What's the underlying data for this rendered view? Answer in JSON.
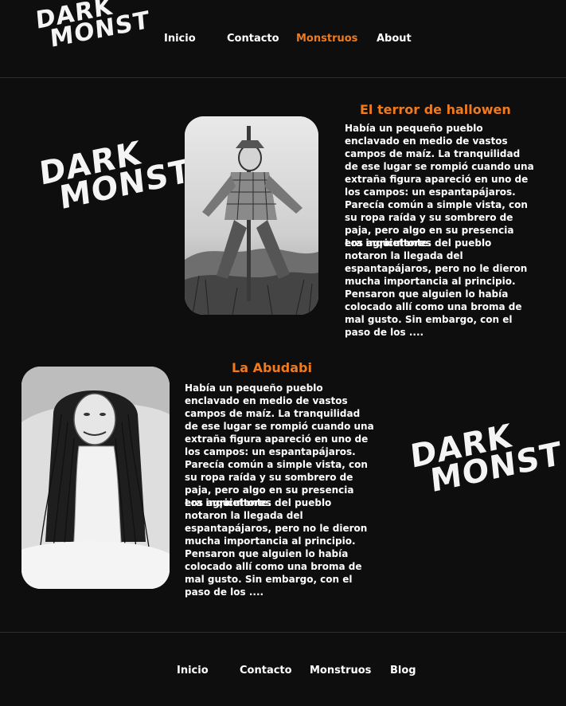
{
  "brand": {
    "line1": "DARK",
    "line2": "MONST"
  },
  "nav": {
    "items": [
      {
        "label": "Inicio"
      },
      {
        "label": "Contacto"
      },
      {
        "label": "Monstruos"
      },
      {
        "label": "About"
      }
    ],
    "active": "Monstruos"
  },
  "colors": {
    "accent": "#f07a1c",
    "background": "#0e0e0e",
    "text": "#ffffff"
  },
  "sections": [
    {
      "title": "El terror de hallowen",
      "paragraphs": [
        "Había un pequeño pueblo enclavado en medio de vastos campos de maíz. La tranquilidad de ese lugar se rompió cuando una extraña figura apareció en uno de los campos: un espantapájaros. Parecía común a simple vista, con su ropa raída y su sombrero de paja, pero algo en su presencia era inquietante.",
        "Los agricultores del pueblo notaron la llegada del espantapájaros, pero no le dieron mucha importancia al principio. Pensaron que alguien lo había colocado allí como una broma de mal gusto. Sin embargo, con el paso de los ...."
      ],
      "image_icon": "scarecrow-illustration"
    },
    {
      "title": "La Abudabi",
      "paragraphs": [
        "Había un pequeño pueblo enclavado en medio de vastos campos de maíz. La tranquilidad de ese lugar se rompió cuando una extraña figura apareció en uno de los campos: un espantapájaros. Parecía común a simple vista, con su ropa raída y su sombrero de paja, pero algo en su presencia era inquietante.",
        "Los agricultores del pueblo notaron la llegada del espantapájaros, pero no le dieron mucha importancia al principio. Pensaron que alguien lo había colocado allí como una broma de mal gusto. Sin embargo, con el paso de los ...."
      ],
      "image_icon": "long-haired-ghost-illustration"
    }
  ],
  "footer": {
    "items": [
      {
        "label": "Inicio"
      },
      {
        "label": "Contacto"
      },
      {
        "label": "Monstruos"
      },
      {
        "label": "Blog"
      }
    ]
  }
}
